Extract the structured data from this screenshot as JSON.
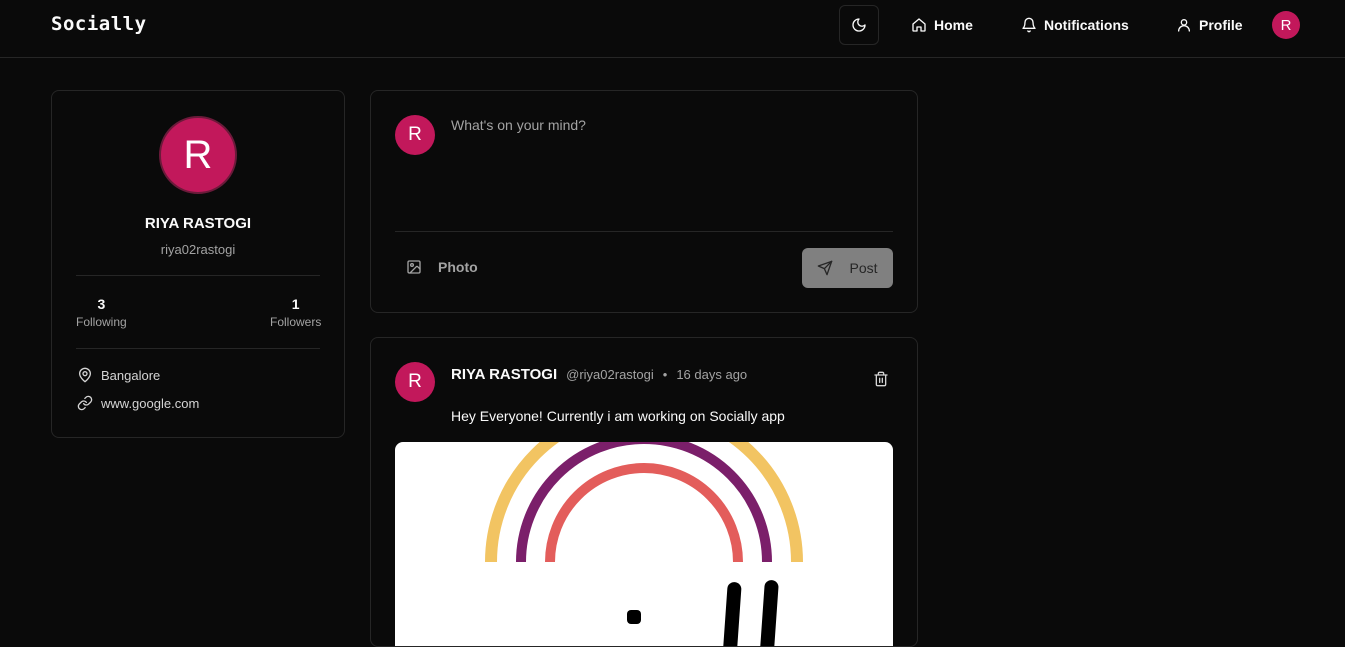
{
  "navbar": {
    "brand": "Socially",
    "home_label": "Home",
    "notifications_label": "Notifications",
    "profile_label": "Profile",
    "avatar_initial": "R"
  },
  "profile": {
    "avatar_initial": "R",
    "name": "RIYA RASTOGI",
    "handle": "riya02rastogi",
    "following_count": "3",
    "following_label": "Following",
    "followers_count": "1",
    "followers_label": "Followers",
    "location": "Bangalore",
    "website": "www.google.com"
  },
  "composer": {
    "avatar_initial": "R",
    "placeholder": "What's on your mind?",
    "photo_label": "Photo",
    "post_label": "Post"
  },
  "posts": [
    {
      "avatar_initial": "R",
      "author": "RIYA RASTOGI",
      "handle": "@riya02rastogi",
      "separator": "•",
      "time": "16 days ago",
      "text": "Hey Everyone! Currently i am working on Socially app"
    }
  ],
  "colors": {
    "background": "#0a0a0a",
    "border": "#262626",
    "avatar": "#c2185b",
    "muted_text": "#a3a3a3",
    "post_button": "#808080"
  },
  "icons": [
    "moon-icon",
    "home-icon",
    "bell-icon",
    "user-icon",
    "map-pin-icon",
    "link-icon",
    "image-icon",
    "send-icon",
    "trash-icon"
  ]
}
